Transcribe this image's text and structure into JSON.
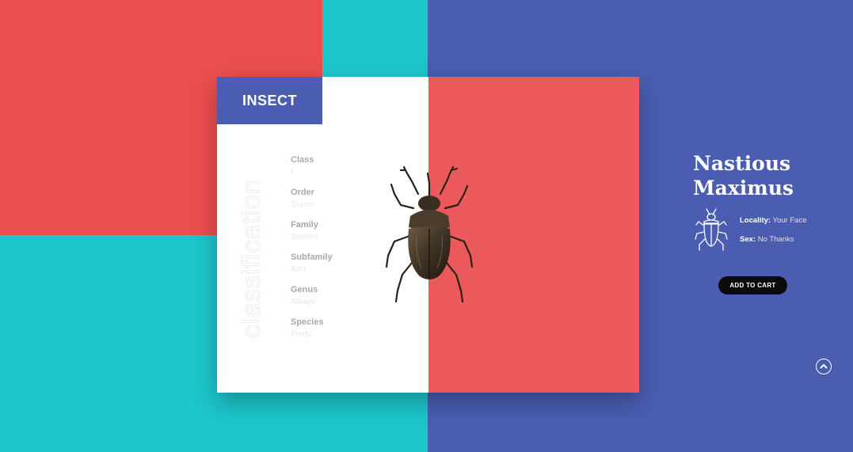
{
  "colors": {
    "red": "#ea4f4e",
    "teal": "#1cc6cb",
    "blue": "#4a5db1",
    "card_right": "#ec595c",
    "button": "#0b0b0b"
  },
  "badge": {
    "label": "INSECT"
  },
  "classification": {
    "heading": "classification",
    "items": [
      {
        "key": "Class",
        "value": "I"
      },
      {
        "key": "Order",
        "value": "Guess"
      },
      {
        "key": "Family",
        "value": "Science"
      },
      {
        "key": "Subfamily",
        "value": "Ain't"
      },
      {
        "key": "Genus",
        "value": "Always"
      },
      {
        "key": "Species",
        "value": "Pretty"
      }
    ]
  },
  "product": {
    "title_line1": "Nastious",
    "title_line2": "Maximus",
    "icon": "beetle-outline-icon",
    "locality_label": "Locality:",
    "locality_value": "Your Face",
    "sex_label": "Sex:",
    "sex_value": "No Thanks",
    "image": "rhinoceros-beetle-photo"
  },
  "actions": {
    "add_to_cart": "ADD TO CART",
    "scroll_up_icon": "chevron-up-circle-icon"
  }
}
